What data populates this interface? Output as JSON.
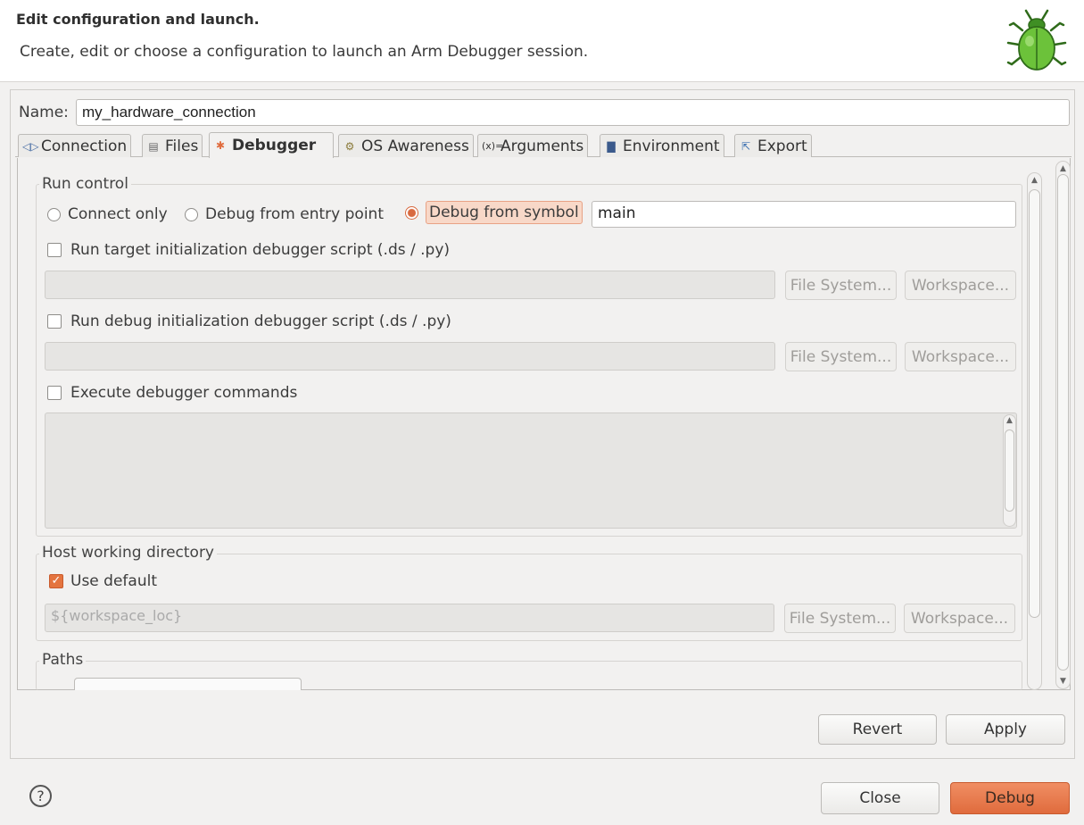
{
  "header": {
    "title": "Edit configuration and launch.",
    "description": "Create, edit or choose a configuration to launch an Arm Debugger session.",
    "icon": "bug-icon"
  },
  "name": {
    "label": "Name:",
    "value": "my_hardware_connection"
  },
  "tabs": [
    {
      "label": "Connection",
      "icon": "connection-icon",
      "active": false
    },
    {
      "label": "Files",
      "icon": "files-icon",
      "active": false
    },
    {
      "label": "Debugger",
      "icon": "debugger-icon",
      "active": true
    },
    {
      "label": "OS Awareness",
      "icon": "os-awareness-icon",
      "active": false
    },
    {
      "label": "Arguments",
      "icon": "arguments-icon",
      "active": false
    },
    {
      "label": "Environment",
      "icon": "environment-icon",
      "active": false
    },
    {
      "label": "Export",
      "icon": "export-icon",
      "active": false
    }
  ],
  "run_control": {
    "label": "Run control",
    "options": [
      "Connect only",
      "Debug from entry point",
      "Debug from symbol"
    ],
    "selected": "Debug from symbol",
    "symbol_value": "main",
    "target_script": {
      "label": "Run target initialization debugger script (.ds / .py)",
      "checked": false,
      "value": ""
    },
    "debug_script": {
      "label": "Run debug initialization debugger script (.ds / .py)",
      "checked": false,
      "value": ""
    },
    "execute_commands": {
      "label": "Execute debugger commands",
      "checked": false
    },
    "file_system_label": "File System...",
    "workspace_label": "Workspace..."
  },
  "host_dir": {
    "label": "Host working directory",
    "use_default_label": "Use default",
    "use_default_checked": true,
    "value": "${workspace_loc}",
    "file_system_label": "File System...",
    "workspace_label": "Workspace..."
  },
  "paths": {
    "label": "Paths"
  },
  "buttons": {
    "revert": "Revert",
    "apply": "Apply",
    "close": "Close",
    "debug": "Debug"
  },
  "help_icon": "?",
  "colors": {
    "accent": "#e06b3d",
    "background": "#f2f1f0"
  }
}
